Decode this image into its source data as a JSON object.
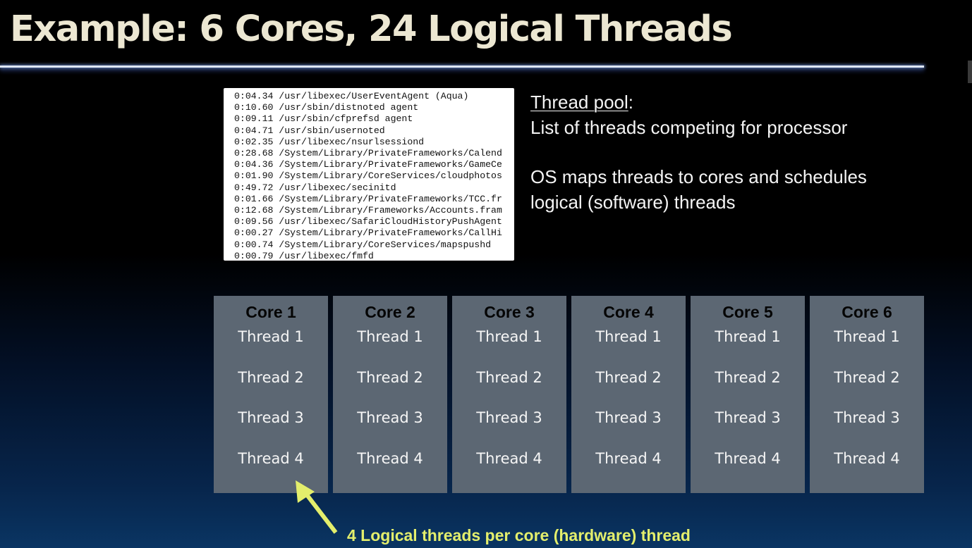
{
  "slide": {
    "title": "Example: 6 Cores, 24 Logical Threads"
  },
  "process_list": {
    "lines": [
      "0:04.34 /usr/libexec/UserEventAgent (Aqua)",
      "0:10.60 /usr/sbin/distnoted agent",
      "0:09.11 /usr/sbin/cfprefsd agent",
      "0:04.71 /usr/sbin/usernoted",
      "0:02.35 /usr/libexec/nsurlsessiond",
      "0:28.68 /System/Library/PrivateFrameworks/Calend",
      "0:04.36 /System/Library/PrivateFrameworks/GameCe",
      "0:01.90 /System/Library/CoreServices/cloudphotos",
      "0:49.72 /usr/libexec/secinitd",
      "0:01.66 /System/Library/PrivateFrameworks/TCC.fr",
      "0:12.68 /System/Library/Frameworks/Accounts.fram",
      "0:09.56 /usr/libexec/SafariCloudHistoryPushAgent",
      "0:00.27 /System/Library/PrivateFrameworks/CallHi",
      "0:00.74 /System/Library/CoreServices/mapspushd",
      "0:00.79 /usr/libexec/fmfd"
    ]
  },
  "thread_pool": {
    "heading": "Thread pool",
    "heading_suffix": ":",
    "line1": "List of threads competing for processor",
    "line2": "OS maps threads to cores and schedules",
    "line3": "logical (software) threads"
  },
  "cores": [
    {
      "name": "Core 1",
      "threads": [
        "Thread 1",
        "Thread 2",
        "Thread 3",
        "Thread 4"
      ]
    },
    {
      "name": "Core 2",
      "threads": [
        "Thread 1",
        "Thread 2",
        "Thread 3",
        "Thread 4"
      ]
    },
    {
      "name": "Core 3",
      "threads": [
        "Thread 1",
        "Thread 2",
        "Thread 3",
        "Thread 4"
      ]
    },
    {
      "name": "Core 4",
      "threads": [
        "Thread 1",
        "Thread 2",
        "Thread 3",
        "Thread 4"
      ]
    },
    {
      "name": "Core 5",
      "threads": [
        "Thread 1",
        "Thread 2",
        "Thread 3",
        "Thread 4"
      ]
    },
    {
      "name": "Core 6",
      "threads": [
        "Thread 1",
        "Thread 2",
        "Thread 3",
        "Thread 4"
      ]
    }
  ],
  "annotation": {
    "text": "4 Logical threads per core (hardware) thread"
  },
  "colors": {
    "title": "#ece7d2",
    "core_box": "#5c6773",
    "annotation": "#e3ee6c"
  }
}
